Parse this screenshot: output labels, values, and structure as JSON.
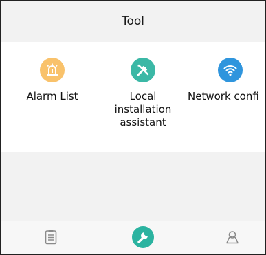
{
  "header": {
    "title": "Tool"
  },
  "tools": [
    {
      "label": "Alarm List",
      "icon": "alarm-icon",
      "color": "#F9C26B"
    },
    {
      "label": "Local\ninstallation\nassistant",
      "icon": "tools-icon",
      "color": "#3BB8A6"
    },
    {
      "label": "Network confi",
      "icon": "wifi-icon",
      "color": "#2F95DD"
    }
  ],
  "tab_bar": {
    "items": [
      {
        "icon": "list-icon",
        "active": false
      },
      {
        "icon": "wrench-icon",
        "active": true,
        "color": "#2BB3A0"
      },
      {
        "icon": "user-icon",
        "active": false
      }
    ]
  }
}
